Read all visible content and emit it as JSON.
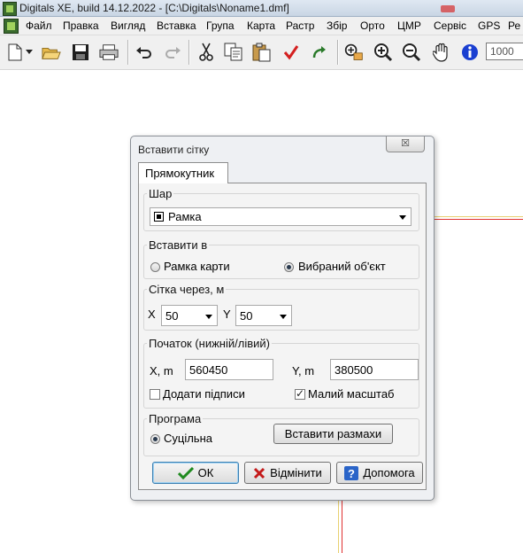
{
  "window": {
    "title": "Digitals XE, build 14.12.2022 - [C:\\Digitals\\Noname1.dmf]"
  },
  "menu": [
    "Файл",
    "Правка",
    "Вигляд",
    "Вставка",
    "Група",
    "Карта",
    "Растр",
    "Збір",
    "Орто",
    "ЦМР",
    "Сервіс",
    "GPS",
    "Ре"
  ],
  "toolbar": {
    "icons": [
      "new-file-icon",
      "dropdown-arrow-icon",
      "open-folder-icon",
      "save-icon",
      "print-icon",
      "undo-icon",
      "redo-icon",
      "cut-icon",
      "copy-icon",
      "paste-icon",
      "checkmark-icon",
      "rotate-arrow-icon",
      "zoom-select-icon",
      "zoom-in-icon",
      "zoom-out-icon",
      "pan-hand-icon",
      "info-icon"
    ],
    "scale_value": "1000"
  },
  "dialog": {
    "title": "Вставити сітку",
    "close_glyph": "☒",
    "tab_label": "Прямокутник",
    "layer": {
      "legend": "Шар",
      "value": "Рамка"
    },
    "insert_into": {
      "legend": "Вставити в",
      "option1": "Рамка карти",
      "option2": "Вибраний об'єкт",
      "selected": "option2"
    },
    "grid_step": {
      "legend": "Сітка через, м",
      "x_label": "X",
      "x_value": "50",
      "y_label": "Y",
      "y_value": "50"
    },
    "origin": {
      "legend": "Початок (нижній/лівий)",
      "x_label": "X, m",
      "x_value": "560450",
      "y_label": "Y, m",
      "y_value": "380500",
      "add_labels": "Додати підписи",
      "add_labels_checked": false,
      "small_scale": "Малий масштаб",
      "small_scale_checked": true
    },
    "program": {
      "legend": "Програма",
      "option": "Суцільна",
      "selected": true,
      "insert_frames_button": "Вставити размахи"
    },
    "buttons": {
      "ok": "ОК",
      "cancel": "Відмінити",
      "help": "Допомога"
    }
  },
  "colors": {
    "map_line_red": "#e03030",
    "map_line_yellow": "#e8d070",
    "accent": "#3c7fb1"
  }
}
